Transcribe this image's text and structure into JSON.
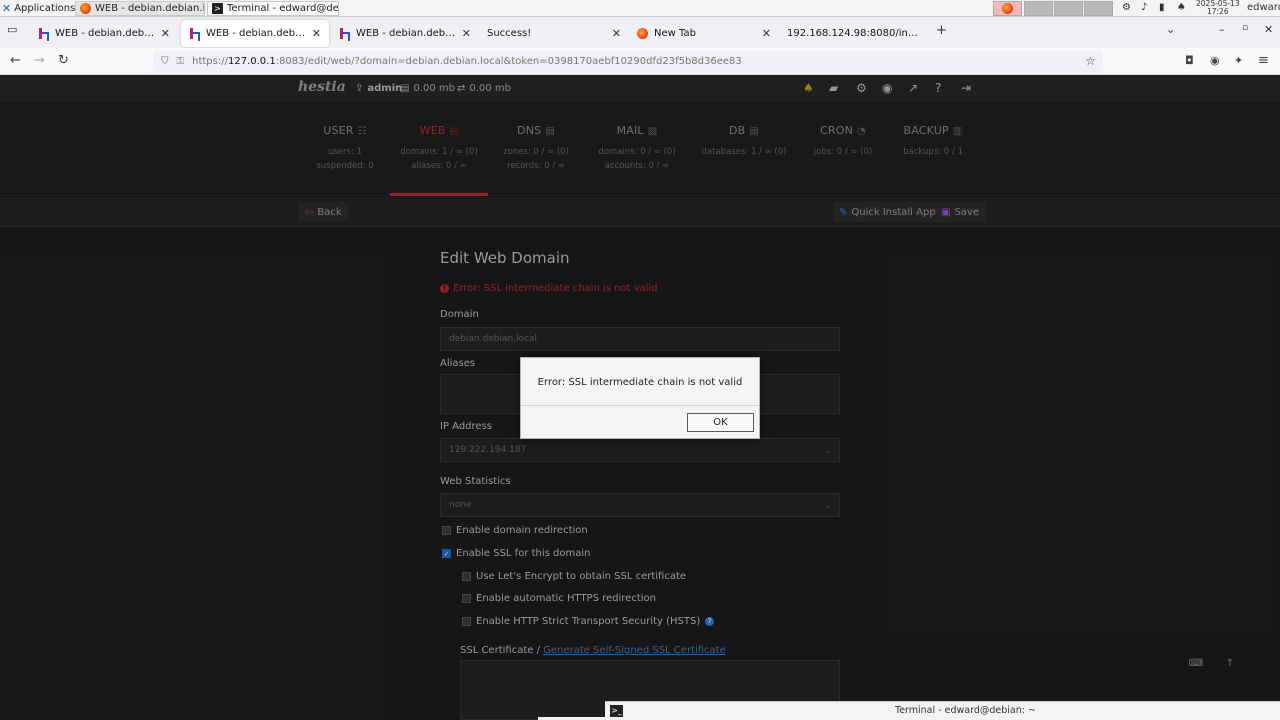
{
  "taskbar": {
    "applications_label": "Applications",
    "tasks": [
      {
        "label": "WEB - debian.debian.lo...",
        "icon": "firefox-icon",
        "active": false
      },
      {
        "label": "Terminal - edward@deb...",
        "icon": "terminal-icon",
        "active": true
      }
    ],
    "clock_date": "2025-05-13",
    "clock_time": "17:26",
    "user": "edward"
  },
  "browser": {
    "tabs": [
      {
        "title": "WEB - debian.debian.local",
        "icon": "hestia-icon",
        "active": false
      },
      {
        "title": "WEB - debian.debian.local",
        "icon": "hestia-icon",
        "active": true
      },
      {
        "title": "WEB - debian.debian.local",
        "icon": "hestia-icon",
        "active": false
      },
      {
        "title": "Success!",
        "icon": "",
        "active": false
      },
      {
        "title": "New Tab",
        "icon": "firefox-icon",
        "active": false
      },
      {
        "title": "192.168.124.98:8080/index",
        "icon": "",
        "active": false
      }
    ],
    "url_prefix": "https://",
    "url_host": "127.0.0.1",
    "url_rest": ":8083/edit/web/?domain=debian.debian.local&token=0398170aebf10290dfd23f5b8d36ee83"
  },
  "header": {
    "logo": "hestia",
    "user": "admin",
    "disk": "0.00 mb",
    "bandwidth": "0.00 mb"
  },
  "main_menu": [
    {
      "label": "USER",
      "glyph": "☷",
      "stats": [
        "users: 1",
        "suspended: 0"
      ],
      "active": false
    },
    {
      "label": "WEB",
      "glyph": "◎",
      "stats": [
        "domains: 1 / ∞ (0)",
        "aliases: 0 / ∞"
      ],
      "active": true
    },
    {
      "label": "DNS",
      "glyph": "▤",
      "stats": [
        "zones: 0 / ∞ (0)",
        "records: 0 / ∞"
      ],
      "active": false
    },
    {
      "label": "MAIL",
      "glyph": "▨",
      "stats": [
        "domains: 0 / ∞ (0)",
        "accounts: 0 / ∞"
      ],
      "active": false
    },
    {
      "label": "DB",
      "glyph": "▤",
      "stats": [
        "databases: 1 / ∞ (0)"
      ],
      "active": false
    },
    {
      "label": "CRON",
      "glyph": "◔",
      "stats": [
        "jobs: 0 / ∞ (0)"
      ],
      "active": false
    },
    {
      "label": "BACKUP",
      "glyph": "▥",
      "stats": [
        "backups: 0 / 1"
      ],
      "active": false
    }
  ],
  "toolbar": {
    "back_label": "Back",
    "quick_install_label": "Quick Install App",
    "save_label": "Save"
  },
  "form": {
    "title": "Edit Web Domain",
    "error": "Error: SSL intermediate chain is not valid",
    "domain_label": "Domain",
    "domain_value": "debian.debian.local",
    "aliases_label": "Aliases",
    "aliases_value": "",
    "ip_label": "IP Address",
    "ip_value": "129.222.194.187",
    "stats_label": "Web Statistics",
    "stats_value": "none",
    "redirect_label": "Enable domain redirection",
    "redirect_checked": false,
    "ssl_label": "Enable SSL for this domain",
    "ssl_checked": true,
    "letsencrypt_label": "Use Let's Encrypt to obtain SSL certificate",
    "https_redirect_label": "Enable automatic HTTPS redirection",
    "hsts_label": "Enable HTTP Strict Transport Security (HSTS)",
    "ssl_cert_label": "SSL Certificate /",
    "generate_link": "Generate Self-Signed SSL Certificate"
  },
  "modal": {
    "message": "Error: SSL intermediate chain is not valid",
    "ok_label": "OK"
  },
  "terminal_panel": {
    "title": "Terminal - edward@debian: ~"
  }
}
